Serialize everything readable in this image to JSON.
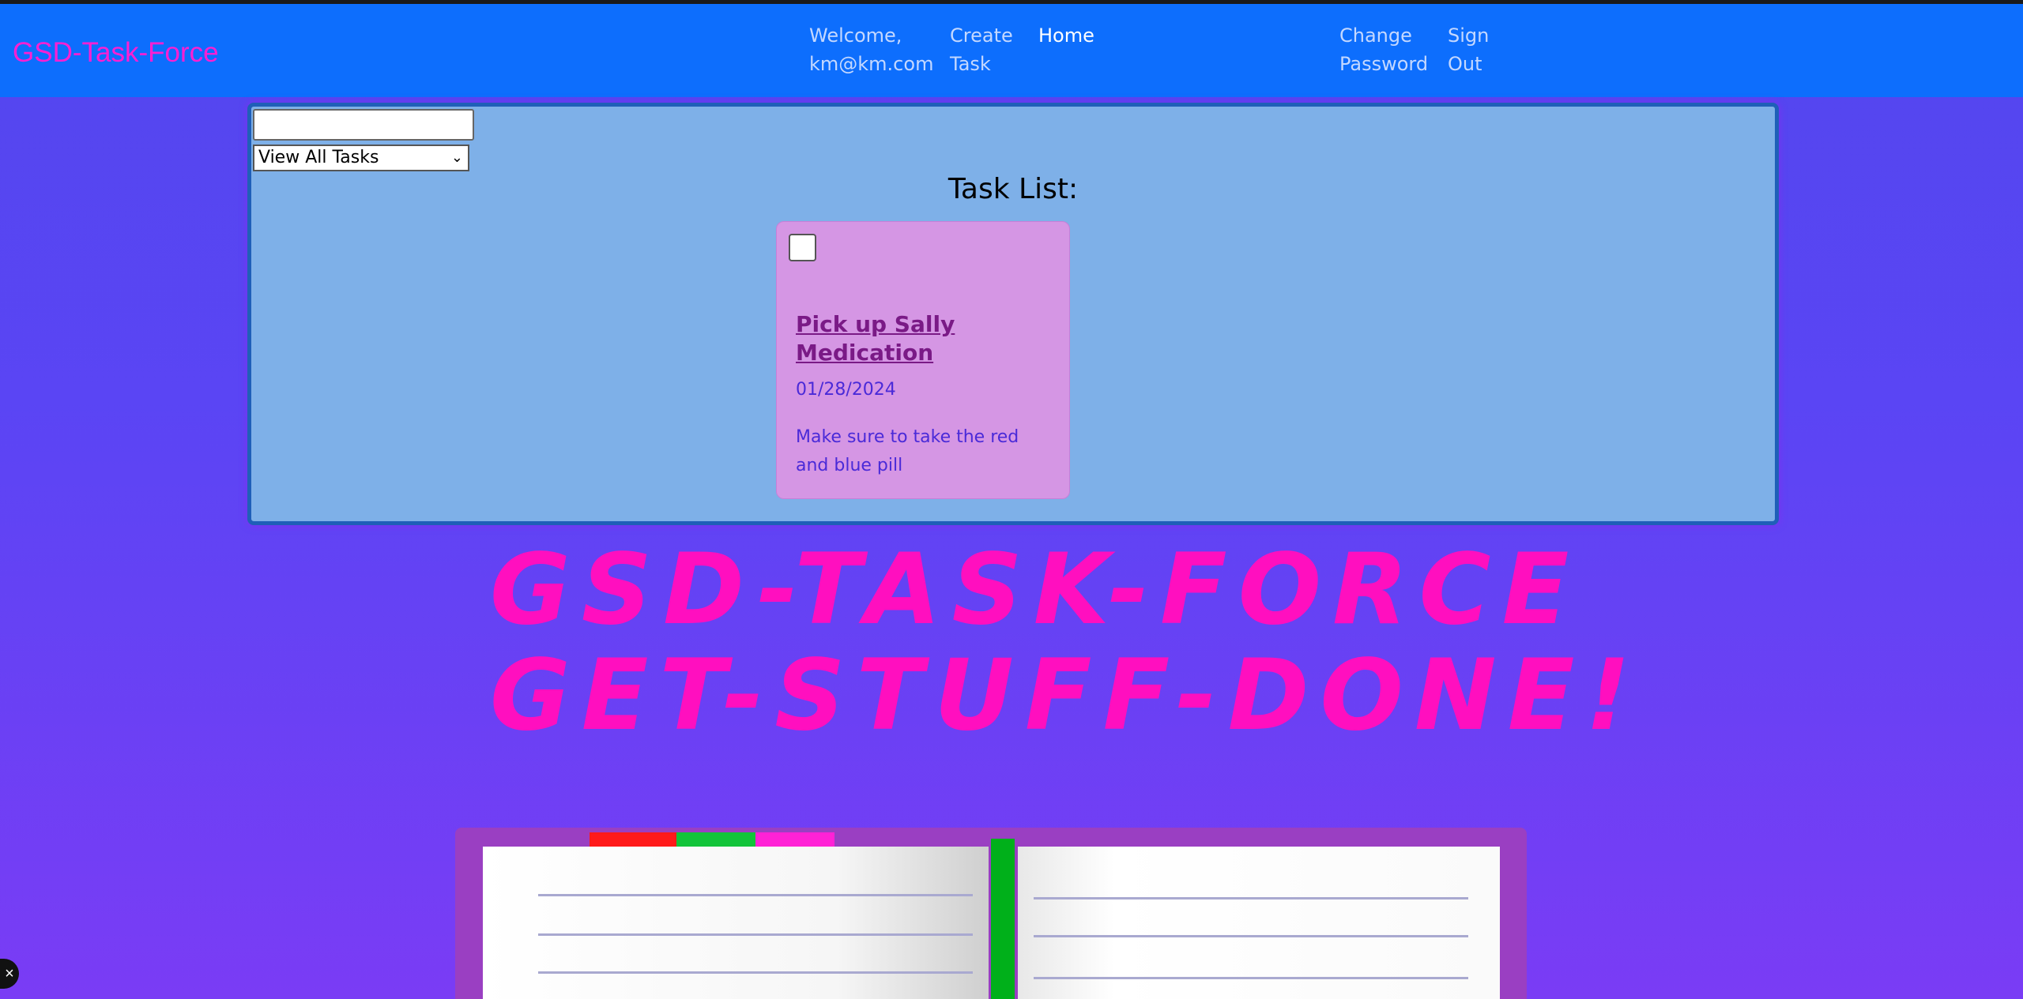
{
  "nav": {
    "brand": "GSD-Task-Force",
    "welcome": "Welcome,\nkm@km.com",
    "create_task": "Create\nTask",
    "home": "Home",
    "change_password": "Change\nPassword",
    "sign_out": "Sign\nOut"
  },
  "controls": {
    "search_value": "",
    "filter_selected": "View All Tasks"
  },
  "task_list": {
    "title": "Task List:",
    "tasks": [
      {
        "checked": false,
        "title": "Pick up Sally Medication",
        "date": "01/28/2024",
        "description": "Make sure to take the red and blue pill"
      }
    ]
  },
  "hero": {
    "line1": "GSD-TASK-FORCE",
    "line2": "GET-STUFF-DONE!"
  },
  "icons": {
    "chevron": "chevron-down-icon",
    "bottom_left": "close-icon"
  },
  "colors": {
    "navbar": "#0d6efd",
    "brand": "#ff1fd2",
    "panel": "#7eb0e8",
    "card": "#d596e4",
    "hero_text": "#ff0fbf"
  }
}
